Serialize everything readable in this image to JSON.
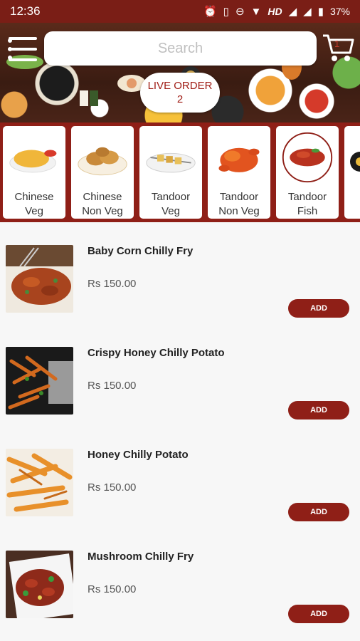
{
  "status_bar": {
    "time": "12:36",
    "network_label": "HD",
    "battery": "37%"
  },
  "header": {
    "search_placeholder": "Search",
    "cart_count": "1",
    "live_order_label": "LIVE ORDER",
    "live_order_count": "2"
  },
  "categories": [
    {
      "label_line1": "Chinese",
      "label_line2": "Veg"
    },
    {
      "label_line1": "Chinese",
      "label_line2": "Non Veg"
    },
    {
      "label_line1": "Tandoor",
      "label_line2": "Veg"
    },
    {
      "label_line1": "Tandoor",
      "label_line2": "Non Veg"
    },
    {
      "label_line1": "Tandoor",
      "label_line2": "Fish"
    }
  ],
  "menu_items": [
    {
      "name": "Baby Corn Chilly Fry",
      "price": "Rs 150.00",
      "add_label": "ADD"
    },
    {
      "name": "Crispy Honey Chilly Potato",
      "price": "Rs 150.00",
      "add_label": "ADD"
    },
    {
      "name": "Honey Chilly Potato",
      "price": "Rs 150.00",
      "add_label": "ADD"
    },
    {
      "name": "Mushroom Chilly Fry",
      "price": "Rs 150.00",
      "add_label": "ADD"
    }
  ],
  "colors": {
    "brand": "#8f1f17",
    "status_bar": "#7a1e16",
    "live_order_text": "#a01d16"
  }
}
